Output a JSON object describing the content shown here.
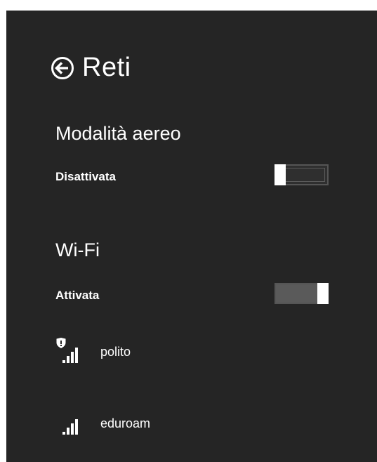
{
  "header": {
    "title": "Reti",
    "back_icon": "back-arrow-circle-icon"
  },
  "airplane_mode": {
    "title": "Modalità aereo",
    "state_label": "Disattivata",
    "on": false
  },
  "wifi": {
    "title": "Wi-Fi",
    "state_label": "Attivata",
    "on": true,
    "networks": [
      {
        "name": "polito",
        "icon": "secured-wifi-signal-icon",
        "signal_bars": 4,
        "secured": true
      },
      {
        "name": "eduroam",
        "icon": "wifi-signal-icon",
        "signal_bars": 4,
        "secured": false
      }
    ]
  },
  "colors": {
    "panel_background": "#252525",
    "page_background": "#ffffff",
    "text": "#ffffff"
  }
}
